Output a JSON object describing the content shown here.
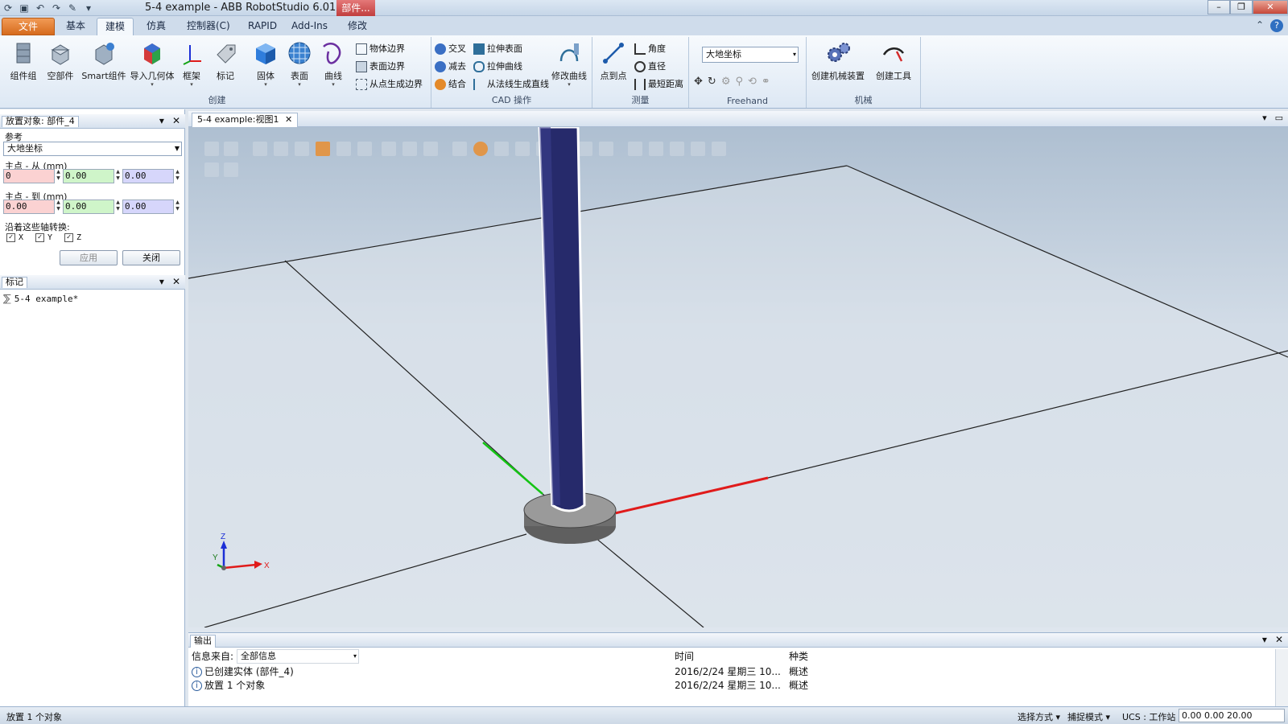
{
  "window": {
    "title": "5-4 example - ABB RobotStudio 6.01.01",
    "context_tab": "部件...",
    "minimize": "–",
    "restore": "❐",
    "close": "✕"
  },
  "ribbon_tabs": [
    {
      "label": "文件 (F)"
    },
    {
      "label": "基本"
    },
    {
      "label": "建模"
    },
    {
      "label": "仿真"
    },
    {
      "label": "控制器(C)"
    },
    {
      "label": "RAPID"
    },
    {
      "label": "Add-Ins"
    },
    {
      "label": "修改"
    }
  ],
  "ribbon": {
    "create": {
      "label": "创建",
      "buttons": [
        "组件组",
        "空部件",
        "Smart组件",
        "导入几何体",
        "框架",
        "标记",
        "固体",
        "表面",
        "曲线"
      ],
      "small": [
        "物体边界",
        "表面边界",
        "从点生成边界"
      ]
    },
    "cad": {
      "label": "CAD 操作",
      "small_left": [
        "交叉",
        "减去",
        "结合"
      ],
      "small_right": [
        "拉伸表面",
        "拉伸曲线",
        "从法线生成直线"
      ],
      "modify_curve": "修改曲线"
    },
    "measure": {
      "label": "测量",
      "point_to_point": "点到点",
      "small": [
        "角度",
        "直径",
        "最短距离"
      ]
    },
    "freehand": {
      "label": "Freehand",
      "reference": "大地坐标"
    },
    "mechanism": {
      "label": "机械",
      "buttons": [
        "创建机械装置",
        "创建工具"
      ]
    }
  },
  "place_panel": {
    "title": "放置对象: 部件_4",
    "reference_label": "参考",
    "reference_value": "大地坐标",
    "from_label": "主点 - 从 (mm)",
    "from_values": [
      "0",
      "0.00",
      "0.00"
    ],
    "to_label": "主点 - 到 (mm)",
    "to_values": [
      "0.00",
      "0.00",
      "0.00"
    ],
    "axes_label": "沿着这些轴转换:",
    "axes": [
      {
        "name": "X",
        "checked": true
      },
      {
        "name": "Y",
        "checked": true
      },
      {
        "name": "Z",
        "checked": true
      }
    ],
    "apply": "应用",
    "close": "关闭"
  },
  "marker_panel": {
    "title": "标记",
    "item": "5-4 example*"
  },
  "viewport": {
    "tab": "5-4 example:视图1",
    "axis_labels": {
      "z": "Z",
      "y": "Y",
      "x": "X"
    },
    "colors": {
      "x_axis": "#e01b1b",
      "y_axis": "#14c414",
      "z_axis": "#1c2fd6",
      "cylinder": "#262a6b",
      "base": "#707070"
    }
  },
  "output": {
    "title": "输出",
    "source_label": "信息来自:",
    "source_value": "全部信息",
    "col_time": "时间",
    "col_type": "种类",
    "rows": [
      {
        "message": "已创建实体 (部件_4)",
        "time": "2016/2/24 星期三 10...",
        "type": "概述"
      },
      {
        "message": "放置 1 个对象",
        "time": "2016/2/24 星期三 10...",
        "type": "概述"
      }
    ]
  },
  "status": {
    "message": "放置 1 个对象",
    "select_mode": "选择方式 ▾",
    "snap_mode": "捕捉模式 ▾",
    "ucs": "UCS : 工作站",
    "coords": "0.00   0.00   20.00"
  }
}
